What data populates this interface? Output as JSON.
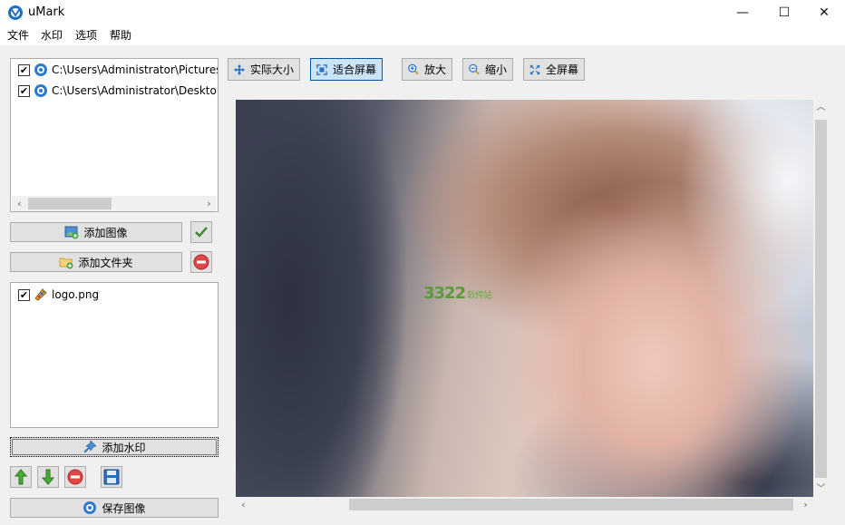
{
  "window": {
    "title": "uMark",
    "minimize_glyph": "—",
    "maximize_glyph": "☐",
    "close_glyph": "✕"
  },
  "menu": [
    "文件",
    "水印",
    "选项",
    "帮助"
  ],
  "image_list": {
    "items": [
      {
        "checked": true,
        "path": "C:\\Users\\Administrator\\Pictures"
      },
      {
        "checked": true,
        "path": "C:\\Users\\Administrator\\Desktop"
      }
    ]
  },
  "buttons": {
    "add_image": "添加图像",
    "add_folder": "添加文件夹",
    "add_watermark": "添加水印",
    "save_image": "保存图像"
  },
  "watermark_list": {
    "items": [
      {
        "checked": true,
        "name": "logo.png"
      }
    ]
  },
  "toolbar": {
    "actual_size": "实际大小",
    "fit_screen": "适合屏幕",
    "zoom_in": "放大",
    "zoom_out": "缩小",
    "fullscreen": "全屏幕"
  },
  "preview": {
    "watermark_text": "3322",
    "watermark_subtext": "软件站"
  },
  "icons": {
    "app": "umark-logo-icon",
    "check": "green-check-icon",
    "remove": "red-minus-icon",
    "move_up": "green-up-arrow-icon",
    "move_down": "green-down-arrow-icon",
    "save": "floppy-disk-icon"
  },
  "colors": {
    "active_toolbar": "#cce4f7",
    "button_face": "#e1e1e1",
    "accent_green": "#4a9e2f",
    "accent_red": "#e04848"
  }
}
